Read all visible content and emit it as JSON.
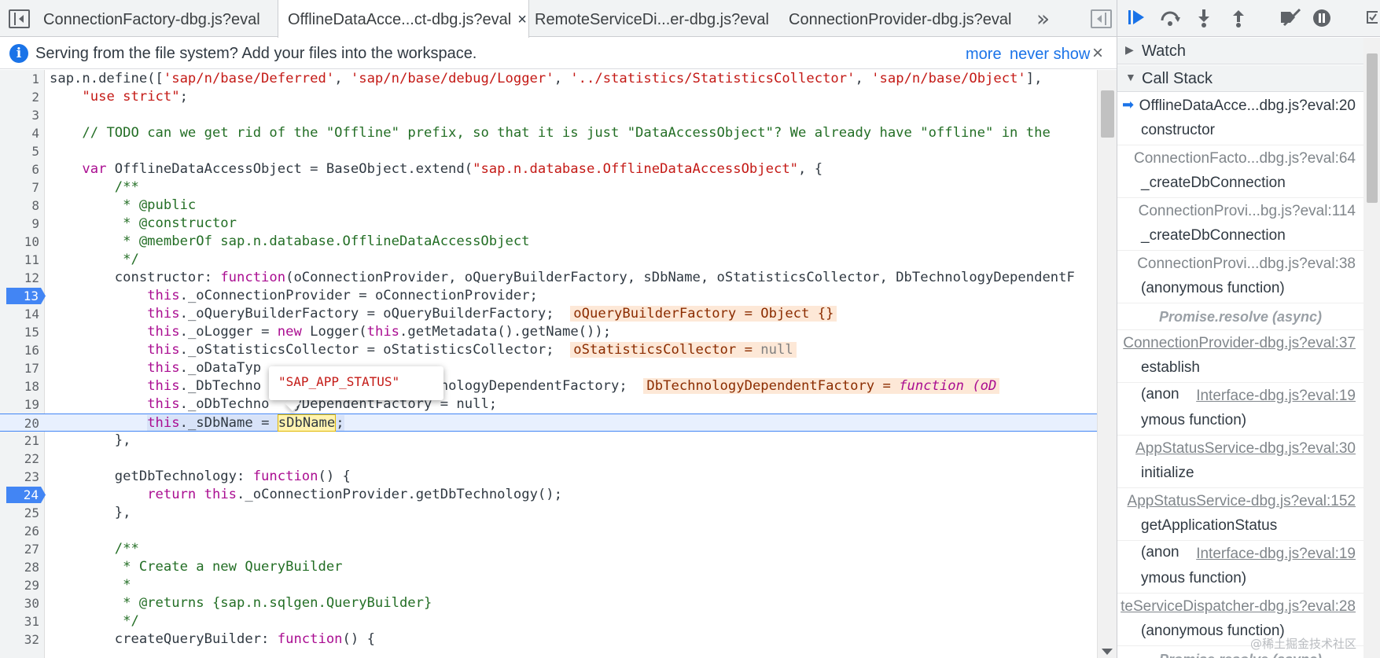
{
  "tabs": [
    {
      "label": "ConnectionFactory-dbg.js?eval",
      "active": false
    },
    {
      "label": "OfflineDataAcce...ct-dbg.js?eval",
      "active": true,
      "close": "×"
    },
    {
      "label": "RemoteServiceDi...er-dbg.js?eval",
      "active": false
    },
    {
      "label": "ConnectionProvider-dbg.js?eval",
      "active": false
    }
  ],
  "tab_overflow": "»",
  "infobar": {
    "text": "Serving from the file system? Add your files into the workspace.",
    "more": "more",
    "never_show": "never show",
    "close": "×",
    "icon": "i"
  },
  "code": {
    "line_numbers": [
      "1",
      "2",
      "3",
      "4",
      "5",
      "6",
      "7",
      "8",
      "9",
      "10",
      "11",
      "12",
      "13",
      "14",
      "15",
      "16",
      "17",
      "18",
      "19",
      "20",
      "21",
      "22",
      "23",
      "24",
      "25",
      "26",
      "27",
      "28",
      "29",
      "30",
      "31",
      "32"
    ],
    "breakpoints": [
      "13",
      "24"
    ],
    "paused_line": "20",
    "inline_values": {
      "l14": "oQueryBuilderFactory = Object {}",
      "l16_name": "oStatisticsCollector = ",
      "l16_val": "null",
      "l18_name": "DbTechnologyDependentFactory = ",
      "l18_val": "function (oD"
    },
    "popover_value": "\"SAP_APP_STATUS\""
  },
  "sidebar": {
    "watch": "Watch",
    "call_stack": "Call Stack",
    "frames": [
      {
        "loc": "OfflineDataAcce...dbg.js?eval:20",
        "fn": "constructor"
      },
      {
        "loc": "ConnectionFacto...dbg.js?eval:64",
        "fn": "_createDbConnection"
      },
      {
        "loc": "ConnectionProvi...bg.js?eval:114",
        "fn": "_createDbConnection"
      },
      {
        "loc": "ConnectionProvi...dbg.js?eval:38",
        "fn": "(anonymous function)"
      }
    ],
    "async1": "Promise.resolve (async)",
    "frames2": {
      "f5_loc": "ConnectionProvider-dbg.js?eval:37",
      "f5_fn": "establish",
      "f6_fn_a": "(anon",
      "f6_loc": "Interface-dbg.js?eval:19",
      "f6_fn_b": "ymous function)",
      "f7_loc": "AppStatusService-dbg.js?eval:30",
      "f7_fn": "initialize",
      "f8_loc": "AppStatusService-dbg.js?eval:152",
      "f8_fn": "getApplicationStatus",
      "f9_fn_a": "(anon",
      "f9_loc": "Interface-dbg.js?eval:19",
      "f9_fn_b": "ymous function)",
      "f10_loc": "teServiceDispatcher-dbg.js?eval:28",
      "f10_fn": "(anonymous function)",
      "async2": "Promise.resolve (async)"
    }
  },
  "watermark": "@稀土掘金技术社区"
}
